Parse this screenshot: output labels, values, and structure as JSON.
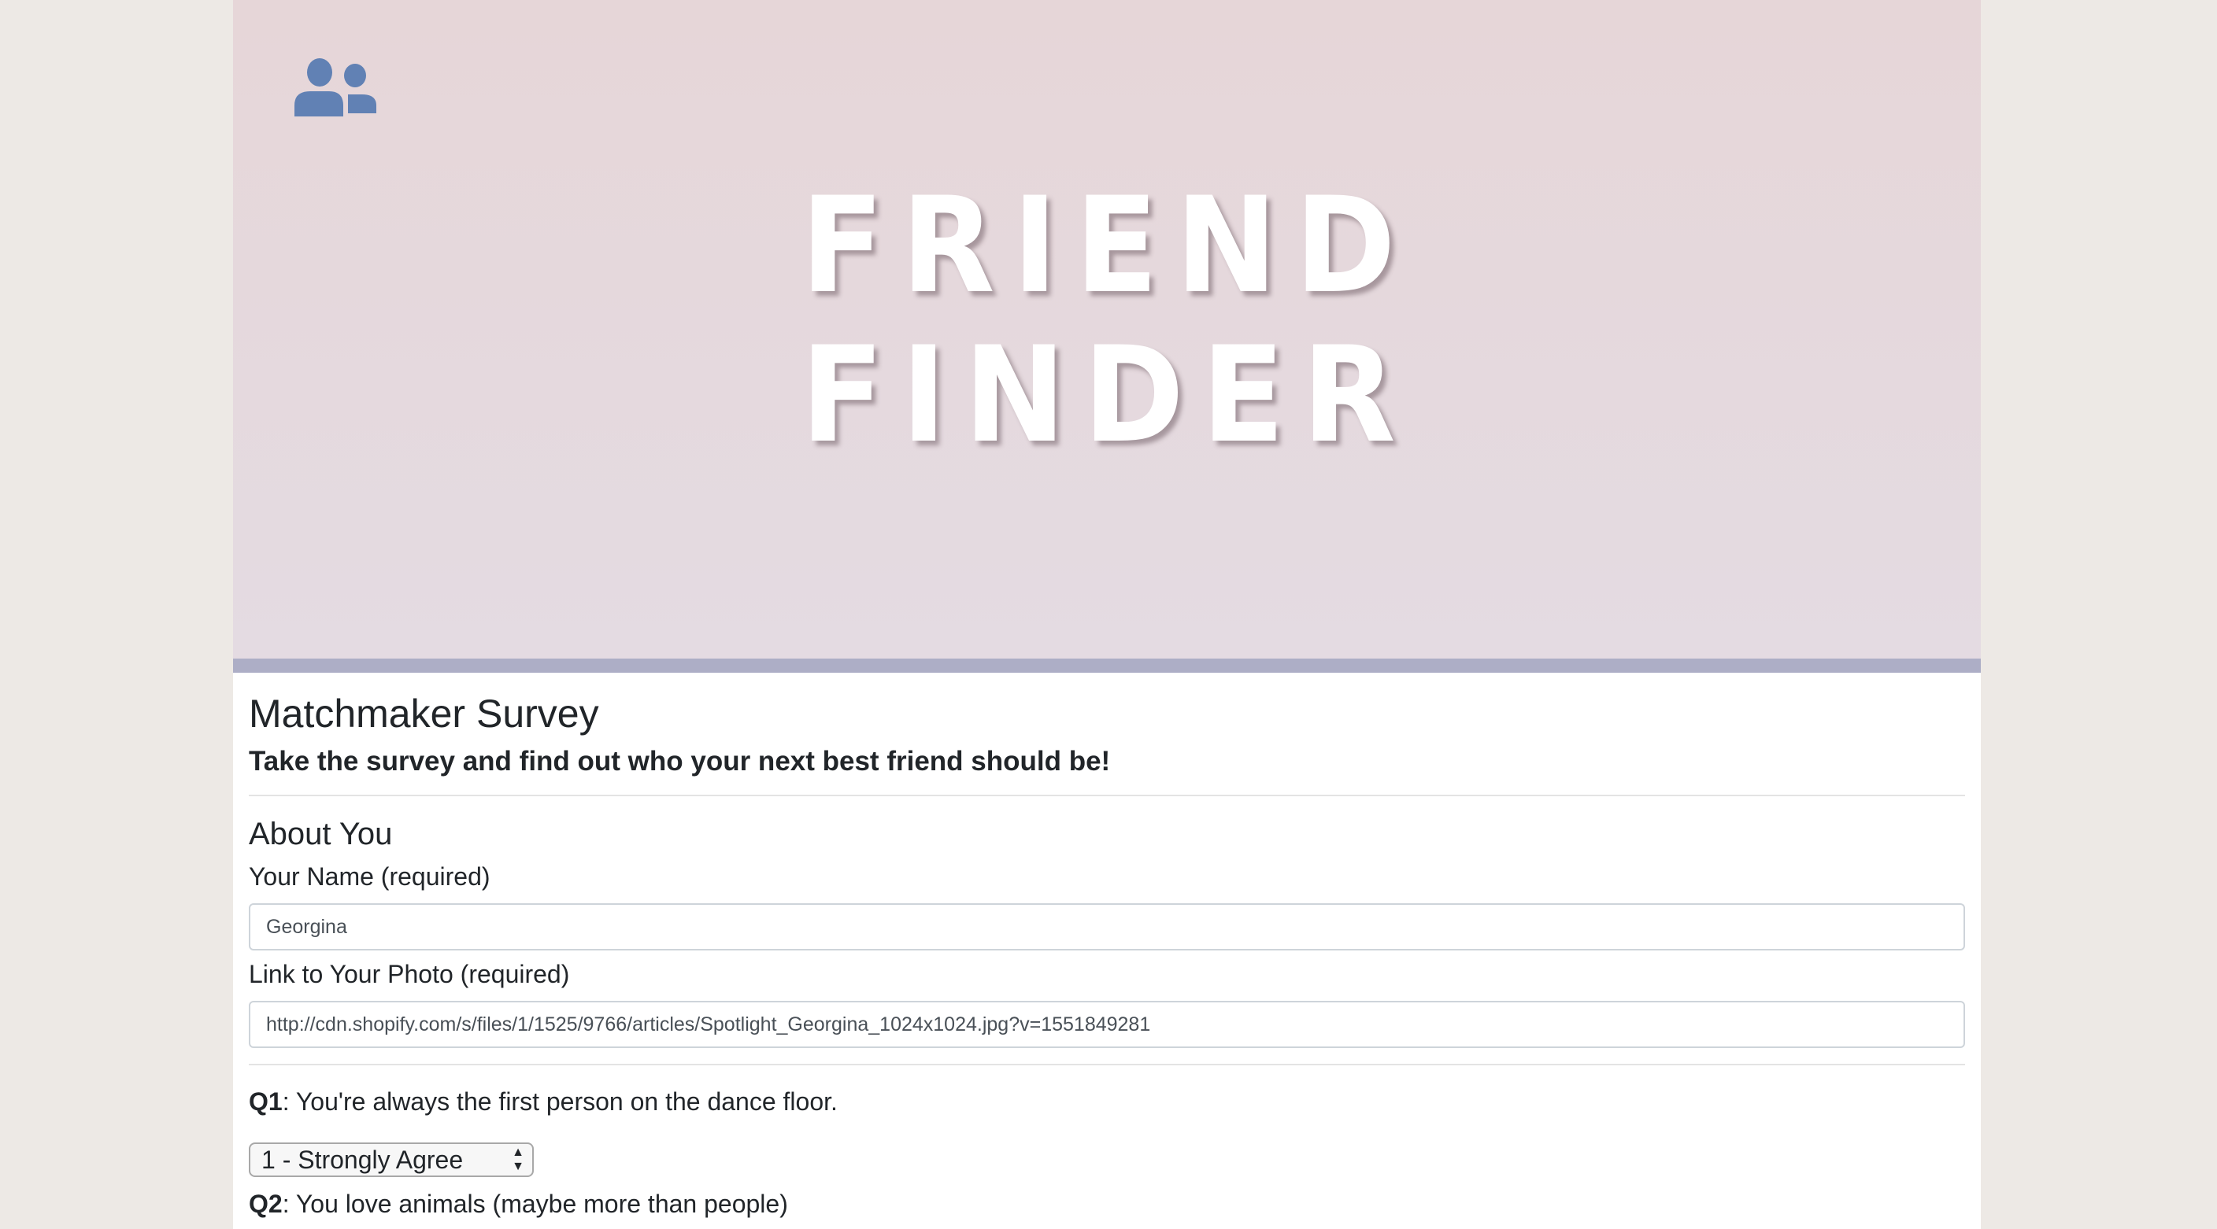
{
  "banner": {
    "title_line1": "FRIEND",
    "title_line2": "FINDER",
    "logo_icon": "users-icon",
    "logo_color": "#6181b4"
  },
  "survey": {
    "title": "Matchmaker Survey",
    "subtitle": "Take the survey and find out who your next best friend should be!",
    "section": "About You",
    "name_label": "Your Name (required)",
    "name_value": "Georgina",
    "photo_label": "Link to Your Photo (required)",
    "photo_value": "http://cdn.shopify.com/s/files/1/1525/9766/articles/Spotlight_Georgina_1024x1024.jpg?v=1551849281",
    "questions": [
      {
        "num": "Q1",
        "text": ": You're always the first person on the dance floor.",
        "selected": "1 - Strongly Agree"
      },
      {
        "num": "Q2",
        "text": ": You love animals (maybe more than people)"
      }
    ]
  }
}
